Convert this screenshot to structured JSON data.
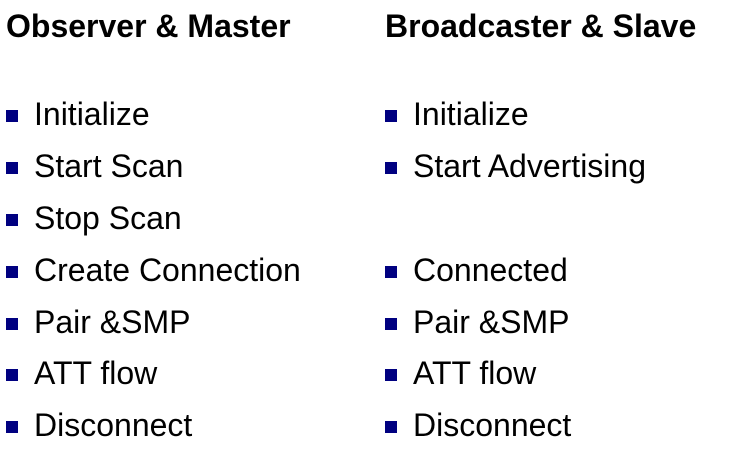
{
  "columns": [
    {
      "title": "Observer & Master",
      "items": [
        "Initialize",
        "Start Scan",
        "Stop Scan",
        "Create Connection",
        "Pair &SMP",
        "ATT flow",
        "Disconnect"
      ]
    },
    {
      "title": "Broadcaster & Slave",
      "items": [
        "Initialize",
        "Start Advertising",
        "",
        "Connected",
        "Pair &SMP",
        "ATT flow",
        "Disconnect"
      ]
    }
  ],
  "colors": {
    "bullet": "#000080",
    "text": "#000000",
    "background": "#ffffff"
  }
}
